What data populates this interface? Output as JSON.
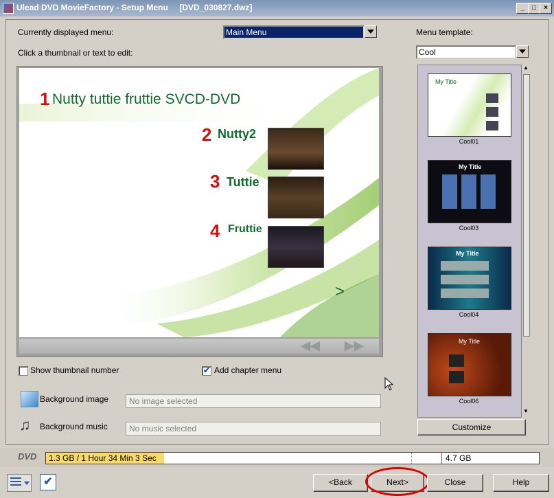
{
  "window": {
    "title": "Ulead DVD MovieFactory - Setup Menu     [DVD_030827.dwz]"
  },
  "menu_select": {
    "label": "Currently displayed menu:",
    "value": "Main Menu"
  },
  "instruction": "Click a thumbnail or text to edit:",
  "preview": {
    "title_num": "1",
    "title": "Nutty tuttie fruttie SVCD-DVD",
    "items": [
      {
        "num": "2",
        "label": "Nutty2"
      },
      {
        "num": "3",
        "label": "Tuttie"
      },
      {
        "num": "4",
        "label": "Fruttie"
      }
    ],
    "next_arrow": ">"
  },
  "options": {
    "show_thumbnail_number": {
      "label": "Show thumbnail number",
      "checked": false
    },
    "add_chapter_menu": {
      "label": "Add chapter menu",
      "checked": true
    }
  },
  "background": {
    "image_label": "Background image",
    "image_value": "No image selected",
    "music_label": "Background music",
    "music_value": "No music selected"
  },
  "template": {
    "label": "Menu template:",
    "value": "Cool",
    "items": [
      {
        "name": "Cool01",
        "title": "My Title"
      },
      {
        "name": "Cool03",
        "title": "My Title"
      },
      {
        "name": "Cool04",
        "title": "My Title"
      },
      {
        "name": "Cool06",
        "title": "My Title"
      }
    ],
    "customize_label": "Customize"
  },
  "capacity": {
    "disc_label": "DVD",
    "used_text": "1.3 GB / 1 Hour 34 Min 3 Sec",
    "max_text": "4.7 GB",
    "used_fraction": 0.24
  },
  "buttons": {
    "back": "<Back",
    "next": "Next>",
    "close": "Close",
    "help": "Help"
  },
  "colors": {
    "accent_red": "#d40f0f",
    "item_green": "#0f6b2e",
    "highlight": "#0a246a"
  }
}
